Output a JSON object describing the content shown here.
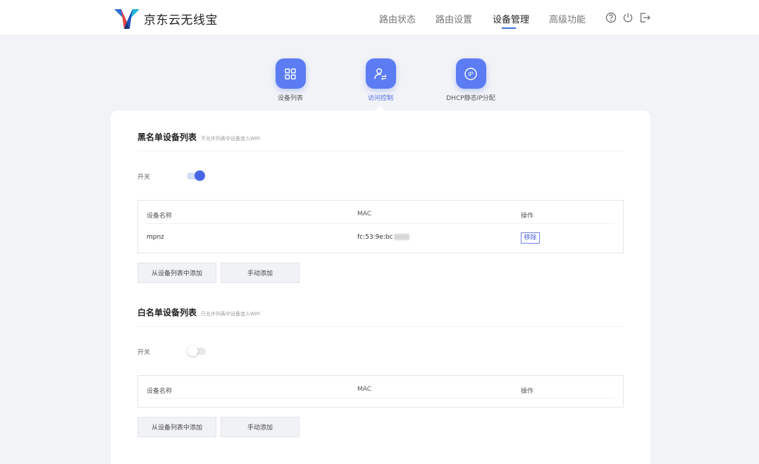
{
  "header": {
    "brand": "京东云无线宝",
    "nav": [
      "路由状态",
      "路由设置",
      "设备管理",
      "高级功能"
    ],
    "active_nav": "设备管理",
    "icons": [
      "help-icon",
      "power-icon",
      "logout-icon"
    ]
  },
  "subtabs": [
    {
      "label": "设备列表",
      "icon": "grid-icon"
    },
    {
      "label": "访问控制",
      "icon": "user-swap-icon"
    },
    {
      "label": "DHCP静态IP分配",
      "icon": "ip-icon"
    }
  ],
  "active_subtab": "访问控制",
  "blacklist": {
    "title": "黑名单设备列表",
    "subtitle": "不允许列表中设备连入WiFi",
    "switch_label": "开关",
    "switch_on": true,
    "columns": [
      "设备名称",
      "MAC",
      "操作"
    ],
    "rows": [
      {
        "name": "mpnz",
        "mac": "fc:53:9e:bc",
        "action": "移除"
      }
    ],
    "buttons": [
      "从设备列表中添加",
      "手动添加"
    ]
  },
  "whitelist": {
    "title": "白名单设备列表",
    "subtitle": "只允许列表中设备连入WiFi",
    "switch_label": "开关",
    "switch_on": false,
    "columns": [
      "设备名称",
      "MAC",
      "操作"
    ],
    "rows": [],
    "buttons": [
      "从设备列表中添加",
      "手动添加"
    ]
  },
  "colors": {
    "accent": "#5b7cf2",
    "toggle_on": "#4766e6",
    "background": "#f2f3f7"
  }
}
